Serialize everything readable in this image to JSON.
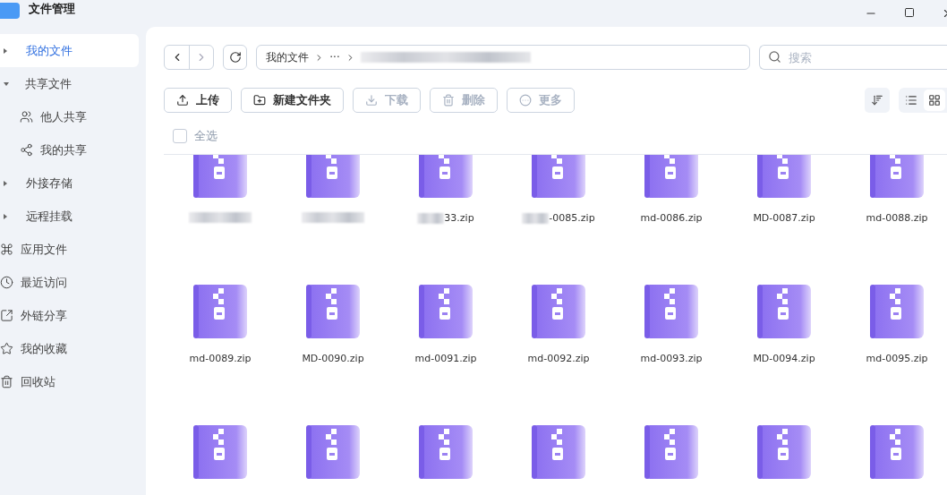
{
  "window": {
    "title": "文件管理"
  },
  "sidebar": {
    "items": [
      {
        "label": "我的文件",
        "kind": "caret",
        "selected": true,
        "expanded": false
      },
      {
        "label": "共享文件",
        "kind": "caret",
        "selected": false,
        "expanded": true,
        "children": [
          {
            "label": "他人共享",
            "kind": "people",
            "selected": false
          },
          {
            "label": "我的共享",
            "kind": "share",
            "selected": false
          }
        ]
      },
      {
        "label": "外接存储",
        "kind": "caret",
        "selected": false,
        "expanded": false
      },
      {
        "label": "远程挂载",
        "kind": "caret",
        "selected": false,
        "expanded": false
      },
      {
        "label": "应用文件",
        "kind": "apps",
        "selected": false
      },
      {
        "label": "最近访问",
        "kind": "clock",
        "selected": false
      },
      {
        "label": "外链分享",
        "kind": "link",
        "selected": false
      },
      {
        "label": "我的收藏",
        "kind": "star",
        "selected": false
      },
      {
        "label": "回收站",
        "kind": "trash",
        "selected": false
      }
    ]
  },
  "breadcrumb": [
    "我的文件",
    "···"
  ],
  "search": {
    "placeholder": "搜索"
  },
  "actions": [
    {
      "label": "上传",
      "kind": "upload",
      "disabled": false
    },
    {
      "label": "新建文件夹",
      "kind": "folder",
      "disabled": false
    },
    {
      "label": "下载",
      "kind": "download",
      "disabled": true
    },
    {
      "label": "删除",
      "kind": "trash",
      "disabled": true
    },
    {
      "label": "更多",
      "kind": "more",
      "disabled": true
    }
  ],
  "view_modes": [
    {
      "kind": "list",
      "selected": false
    },
    {
      "kind": "grid",
      "selected": true
    }
  ],
  "select_all": {
    "label": "全选",
    "checked": false
  },
  "files": [
    {
      "kind": "zip",
      "redacted": true
    },
    {
      "kind": "zip",
      "redacted": true
    },
    {
      "kind": "zip",
      "name": "33.zip",
      "redacted": true
    },
    {
      "kind": "zip",
      "name": "-0085.zip",
      "redacted": true
    },
    {
      "kind": "zip",
      "name": "md-0086.zip"
    },
    {
      "kind": "zip",
      "name": "MD-0087.zip"
    },
    {
      "kind": "zip",
      "name": "md-0088.zip"
    },
    {
      "kind": "zip",
      "name": "md-0089.zip"
    },
    {
      "kind": "zip",
      "name": "MD-0090.zip"
    },
    {
      "kind": "zip",
      "name": "md-0091.zip"
    },
    {
      "kind": "zip",
      "name": "md-0092.zip"
    },
    {
      "kind": "zip",
      "name": "md-0093.zip"
    },
    {
      "kind": "zip",
      "name": "MD-0094.zip"
    },
    {
      "kind": "zip",
      "name": "md-0095.zip"
    },
    {
      "kind": "zip"
    },
    {
      "kind": "zip"
    },
    {
      "kind": "zip"
    },
    {
      "kind": "zip"
    },
    {
      "kind": "zip"
    },
    {
      "kind": "zip"
    },
    {
      "kind": "zip"
    }
  ]
}
